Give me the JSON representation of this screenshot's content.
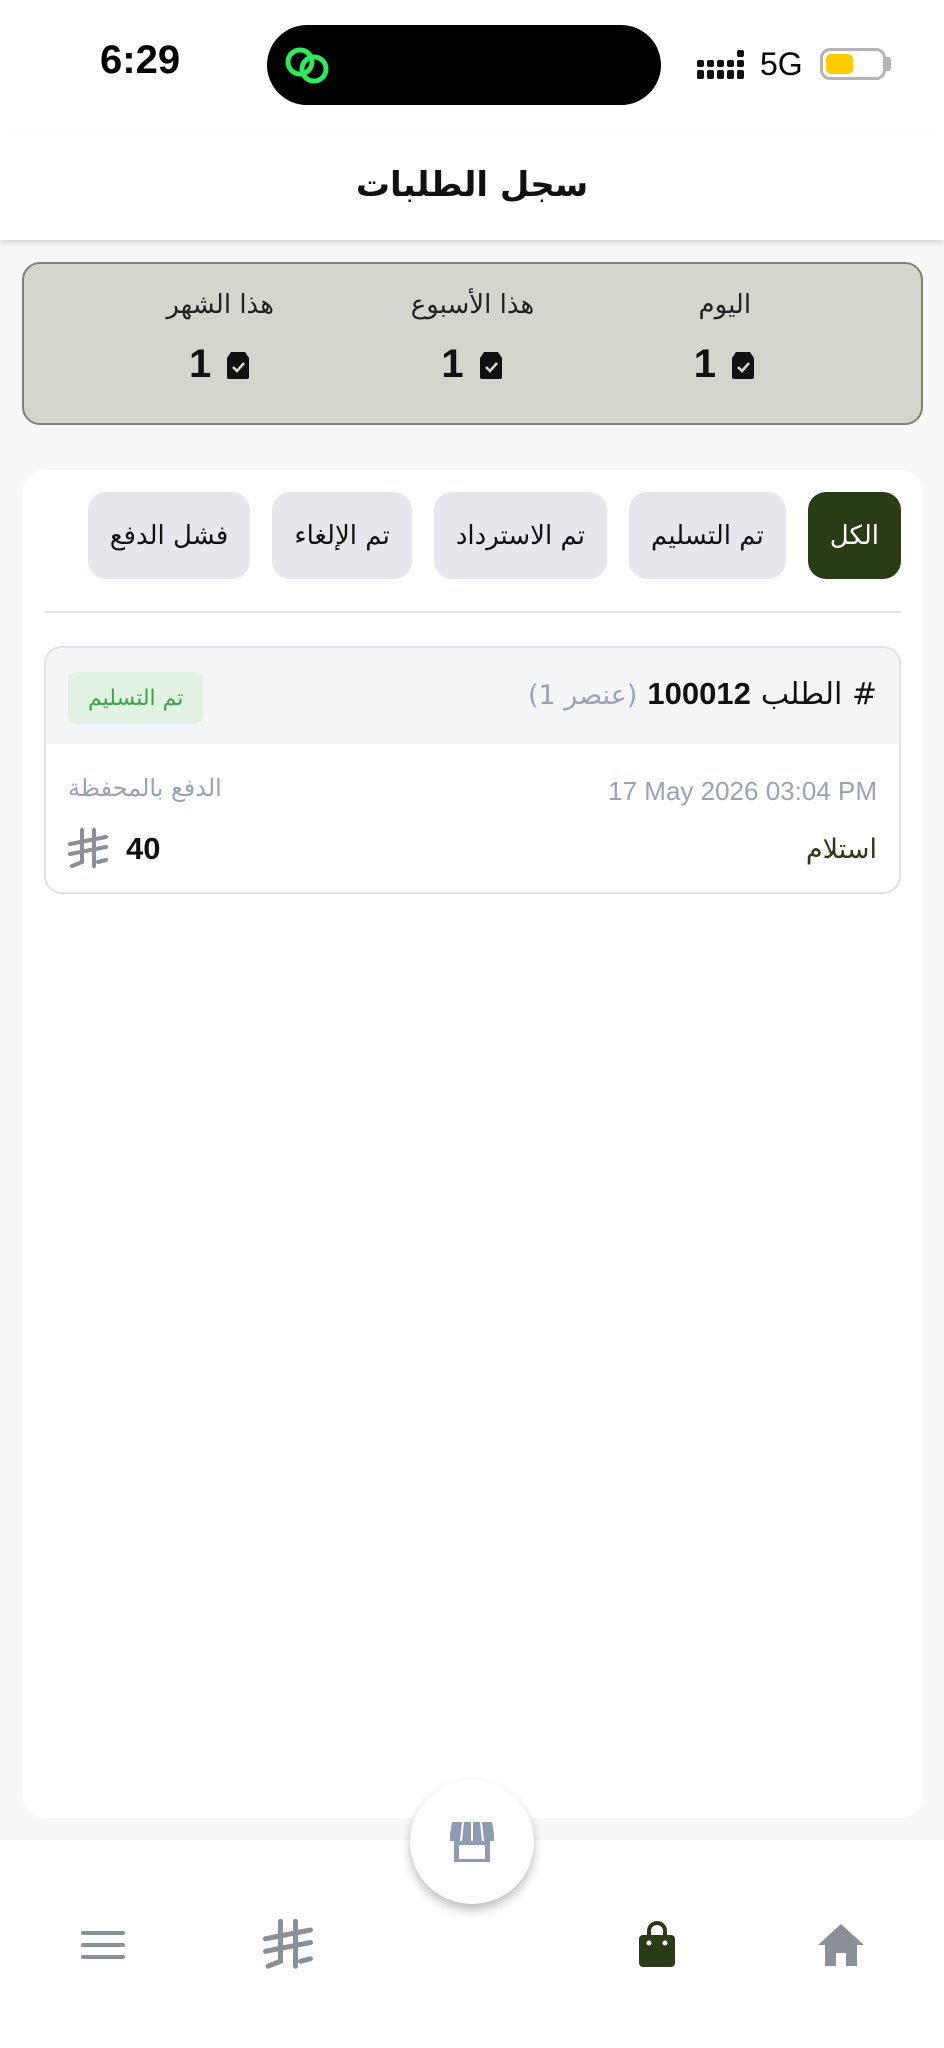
{
  "status_bar": {
    "time": "6:29",
    "network": "5G",
    "battery_level": 0.5,
    "battery_color": "#ffcc00"
  },
  "header": {
    "title": "سجل الطلبات"
  },
  "stats": [
    {
      "label": "اليوم",
      "value": "1",
      "icon": "package-icon"
    },
    {
      "label": "هذا الأسبوع",
      "value": "1",
      "icon": "package-icon"
    },
    {
      "label": "هذا الشهر",
      "value": "1",
      "icon": "package-icon"
    }
  ],
  "filters": [
    {
      "label": "الكل",
      "active": true
    },
    {
      "label": "تم التسليم",
      "active": false
    },
    {
      "label": "تم الاسترداد",
      "active": false
    },
    {
      "label": "تم الإلغاء",
      "active": false
    },
    {
      "label": "فشل الدفع",
      "active": false
    }
  ],
  "orders": [
    {
      "label": "الطلب #",
      "number": "100012",
      "items": "(1 عنصر)",
      "status": "تم التسليم",
      "date": "17 May 2026  03:04 PM",
      "payment_method": "الدفع بالمحفظة",
      "delivery_type": "استلام",
      "total": "40",
      "currency_icon": "riyal-icon"
    }
  ],
  "nav": {
    "items": [
      "home-icon",
      "bag-icon",
      "store-icon",
      "riyal-icon",
      "menu-icon"
    ],
    "active": "bag-icon"
  },
  "colors": {
    "accent": "#2a3c16",
    "stats_bg": "#d3d6cc",
    "status_delivered_bg": "#e2f2e2",
    "status_delivered_text": "#3fa34a",
    "muted_text": "#9aa3b3"
  }
}
